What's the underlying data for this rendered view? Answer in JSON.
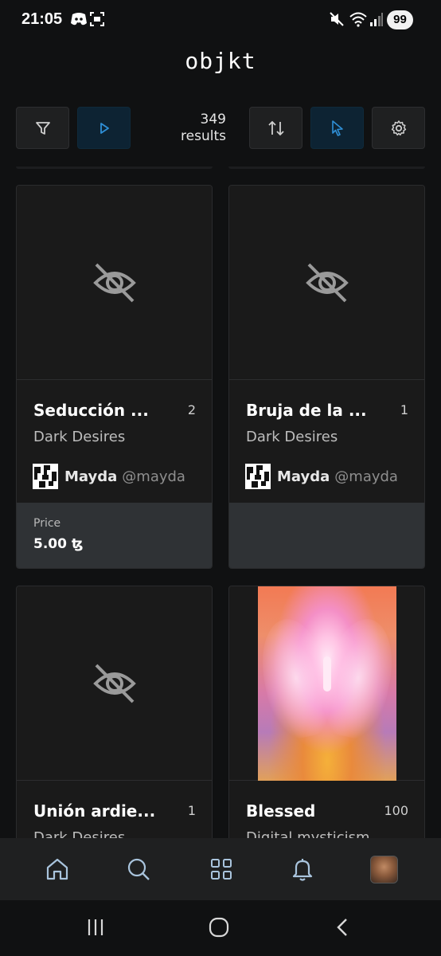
{
  "status_bar": {
    "time": "21:05",
    "battery": "99",
    "icons": [
      "discord-icon",
      "screenshot-icon",
      "mute-icon",
      "wifi-icon",
      "signal-icon"
    ]
  },
  "header": {
    "title": "objkt"
  },
  "toolbar": {
    "results_count": "349",
    "results_label": "results",
    "buttons": [
      "filter-icon",
      "play-icon",
      "sort-icon",
      "cursor-icon",
      "gear-icon"
    ]
  },
  "cards": [
    {
      "title": "Seducción ...",
      "count": "2",
      "collection": "Dark Desires",
      "artist_name": "Mayda",
      "artist_handle": "@mayda",
      "price_label": "Price",
      "price_value": "5.00 ꜩ",
      "media": "hidden"
    },
    {
      "title": "Bruja de la ...",
      "count": "1",
      "collection": "Dark Desires",
      "artist_name": "Mayda",
      "artist_handle": "@mayda",
      "media": "hidden"
    },
    {
      "title": "Unión ardie...",
      "count": "1",
      "collection": "Dark Desires",
      "media": "hidden"
    },
    {
      "title": "Blessed",
      "count": "100",
      "collection": "Digital mysticism",
      "media": "image"
    }
  ],
  "bottom_nav": [
    "home-icon",
    "search-icon",
    "grid-icon",
    "bell-icon",
    "profile-avatar"
  ],
  "system_nav": [
    "recent-apps-icon",
    "home-circle-icon",
    "back-icon"
  ],
  "colors": {
    "accent": "#2f8fd6",
    "background": "#101112",
    "card": "#1a1a1a",
    "footer": "#2f3235"
  }
}
